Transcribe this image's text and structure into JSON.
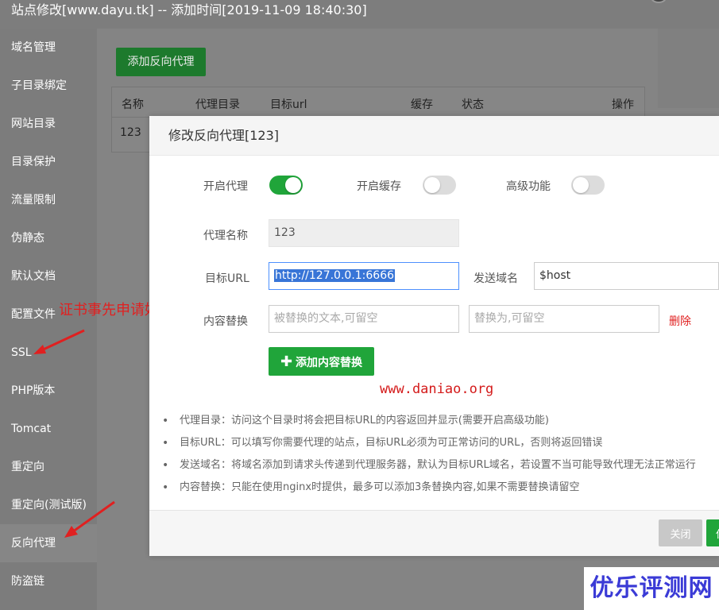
{
  "window": {
    "title": "站点修改[www.dayu.tk] -- 添加时间[2019-11-09 18:40:30]"
  },
  "sidebar": {
    "items": [
      {
        "label": "域名管理"
      },
      {
        "label": "子目录绑定"
      },
      {
        "label": "网站目录"
      },
      {
        "label": "目录保护"
      },
      {
        "label": "流量限制"
      },
      {
        "label": "伪静态"
      },
      {
        "label": "默认文档"
      },
      {
        "label": "配置文件"
      },
      {
        "label": "SSL"
      },
      {
        "label": "PHP版本"
      },
      {
        "label": "Tomcat"
      },
      {
        "label": "重定向"
      },
      {
        "label": "重定向(测试版)"
      },
      {
        "label": "反向代理",
        "active": true
      },
      {
        "label": "防盗链"
      }
    ]
  },
  "main": {
    "add_button": "添加反向代理",
    "table": {
      "columns": [
        "名称",
        "代理目录",
        "目标url",
        "缓存",
        "状态",
        "操作"
      ],
      "rows": [
        {
          "name": "123"
        }
      ]
    }
  },
  "annotations": {
    "note": "证书事先申请好",
    "watermark": "www.daniao.org",
    "logo": "优乐评测网",
    "color": "#e02020"
  },
  "modal": {
    "title": "修改反向代理[123]",
    "enable_proxy_label": "开启代理",
    "enable_proxy": true,
    "enable_cache_label": "开启缓存",
    "enable_cache": false,
    "advanced_label": "高级功能",
    "advanced": false,
    "proxy_name_label": "代理名称",
    "proxy_name_value": "123",
    "target_url_label": "目标URL",
    "target_url_value": "http://127.0.0.1:6666",
    "send_domain_label": "发送域名",
    "send_domain_value": "$host",
    "content_replace_label": "内容替换",
    "replace_from_placeholder": "被替换的文本,可留空",
    "replace_to_placeholder": "替换为,可留空",
    "delete_label": "删除",
    "add_replace_button": "添加内容替换",
    "tips": [
      "代理目录：访问这个目录时将会把目标URL的内容返回并显示(需要开启高级功能)",
      "目标URL：可以填写你需要代理的站点，目标URL必须为可正常访问的URL，否则将返回错误",
      "发送域名：将域名添加到请求头传递到代理服务器，默认为目标URL域名，若设置不当可能导致代理无法正常运行",
      "内容替换：只能在使用nginx时提供，最多可以添加3条替换内容,如果不需要替换请留空"
    ],
    "close_button": "关闭",
    "confirm_button": "保存"
  },
  "colors": {
    "accent": "#20a53a",
    "link_danger": "#e02020",
    "focus": "#4d90fe"
  }
}
